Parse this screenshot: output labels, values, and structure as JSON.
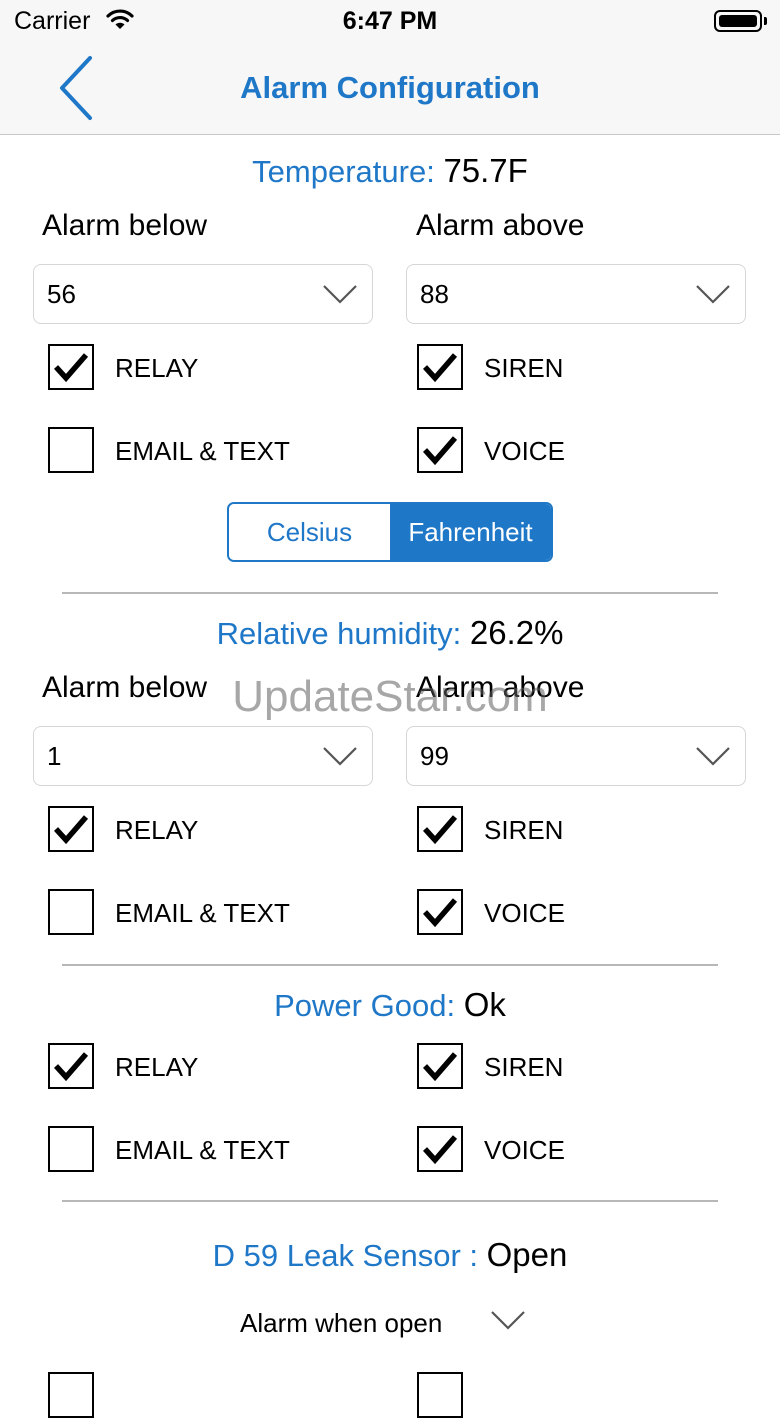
{
  "status": {
    "carrier": "Carrier",
    "time": "6:47 PM"
  },
  "nav": {
    "title": "Alarm Configuration",
    "back_icon": "chevron-left-icon"
  },
  "temperature": {
    "label": "Temperature:",
    "value": "75.7F",
    "below_label": "Alarm below",
    "above_label": "Alarm above",
    "below_value": "56",
    "above_value": "88",
    "relay": {
      "label": "RELAY",
      "checked": true
    },
    "email": {
      "label": "EMAIL & TEXT",
      "checked": false
    },
    "siren": {
      "label": "SIREN",
      "checked": true
    },
    "voice": {
      "label": "VOICE",
      "checked": true
    },
    "units": {
      "celsius": "Celsius",
      "fahrenheit": "Fahrenheit",
      "selected": "Fahrenheit"
    }
  },
  "humidity": {
    "label": "Relative humidity:",
    "value": "26.2%",
    "below_label": "Alarm below",
    "above_label": "Alarm above",
    "below_value": "1",
    "above_value": "99",
    "relay": {
      "label": "RELAY",
      "checked": true
    },
    "email": {
      "label": "EMAIL & TEXT",
      "checked": false
    },
    "siren": {
      "label": "SIREN",
      "checked": true
    },
    "voice": {
      "label": "VOICE",
      "checked": true
    }
  },
  "power": {
    "label": "Power Good:",
    "value": "Ok",
    "relay": {
      "label": "RELAY",
      "checked": true
    },
    "email": {
      "label": "EMAIL & TEXT",
      "checked": false
    },
    "siren": {
      "label": "SIREN",
      "checked": true
    },
    "voice": {
      "label": "VOICE",
      "checked": true
    }
  },
  "leak": {
    "label": "D 59 Leak Sensor :",
    "value": "Open",
    "alarm_mode": "Alarm when open"
  },
  "watermark": "UpdateStar.com",
  "colors": {
    "accent": "#1f77c8",
    "divider": "#b8b8b8"
  }
}
